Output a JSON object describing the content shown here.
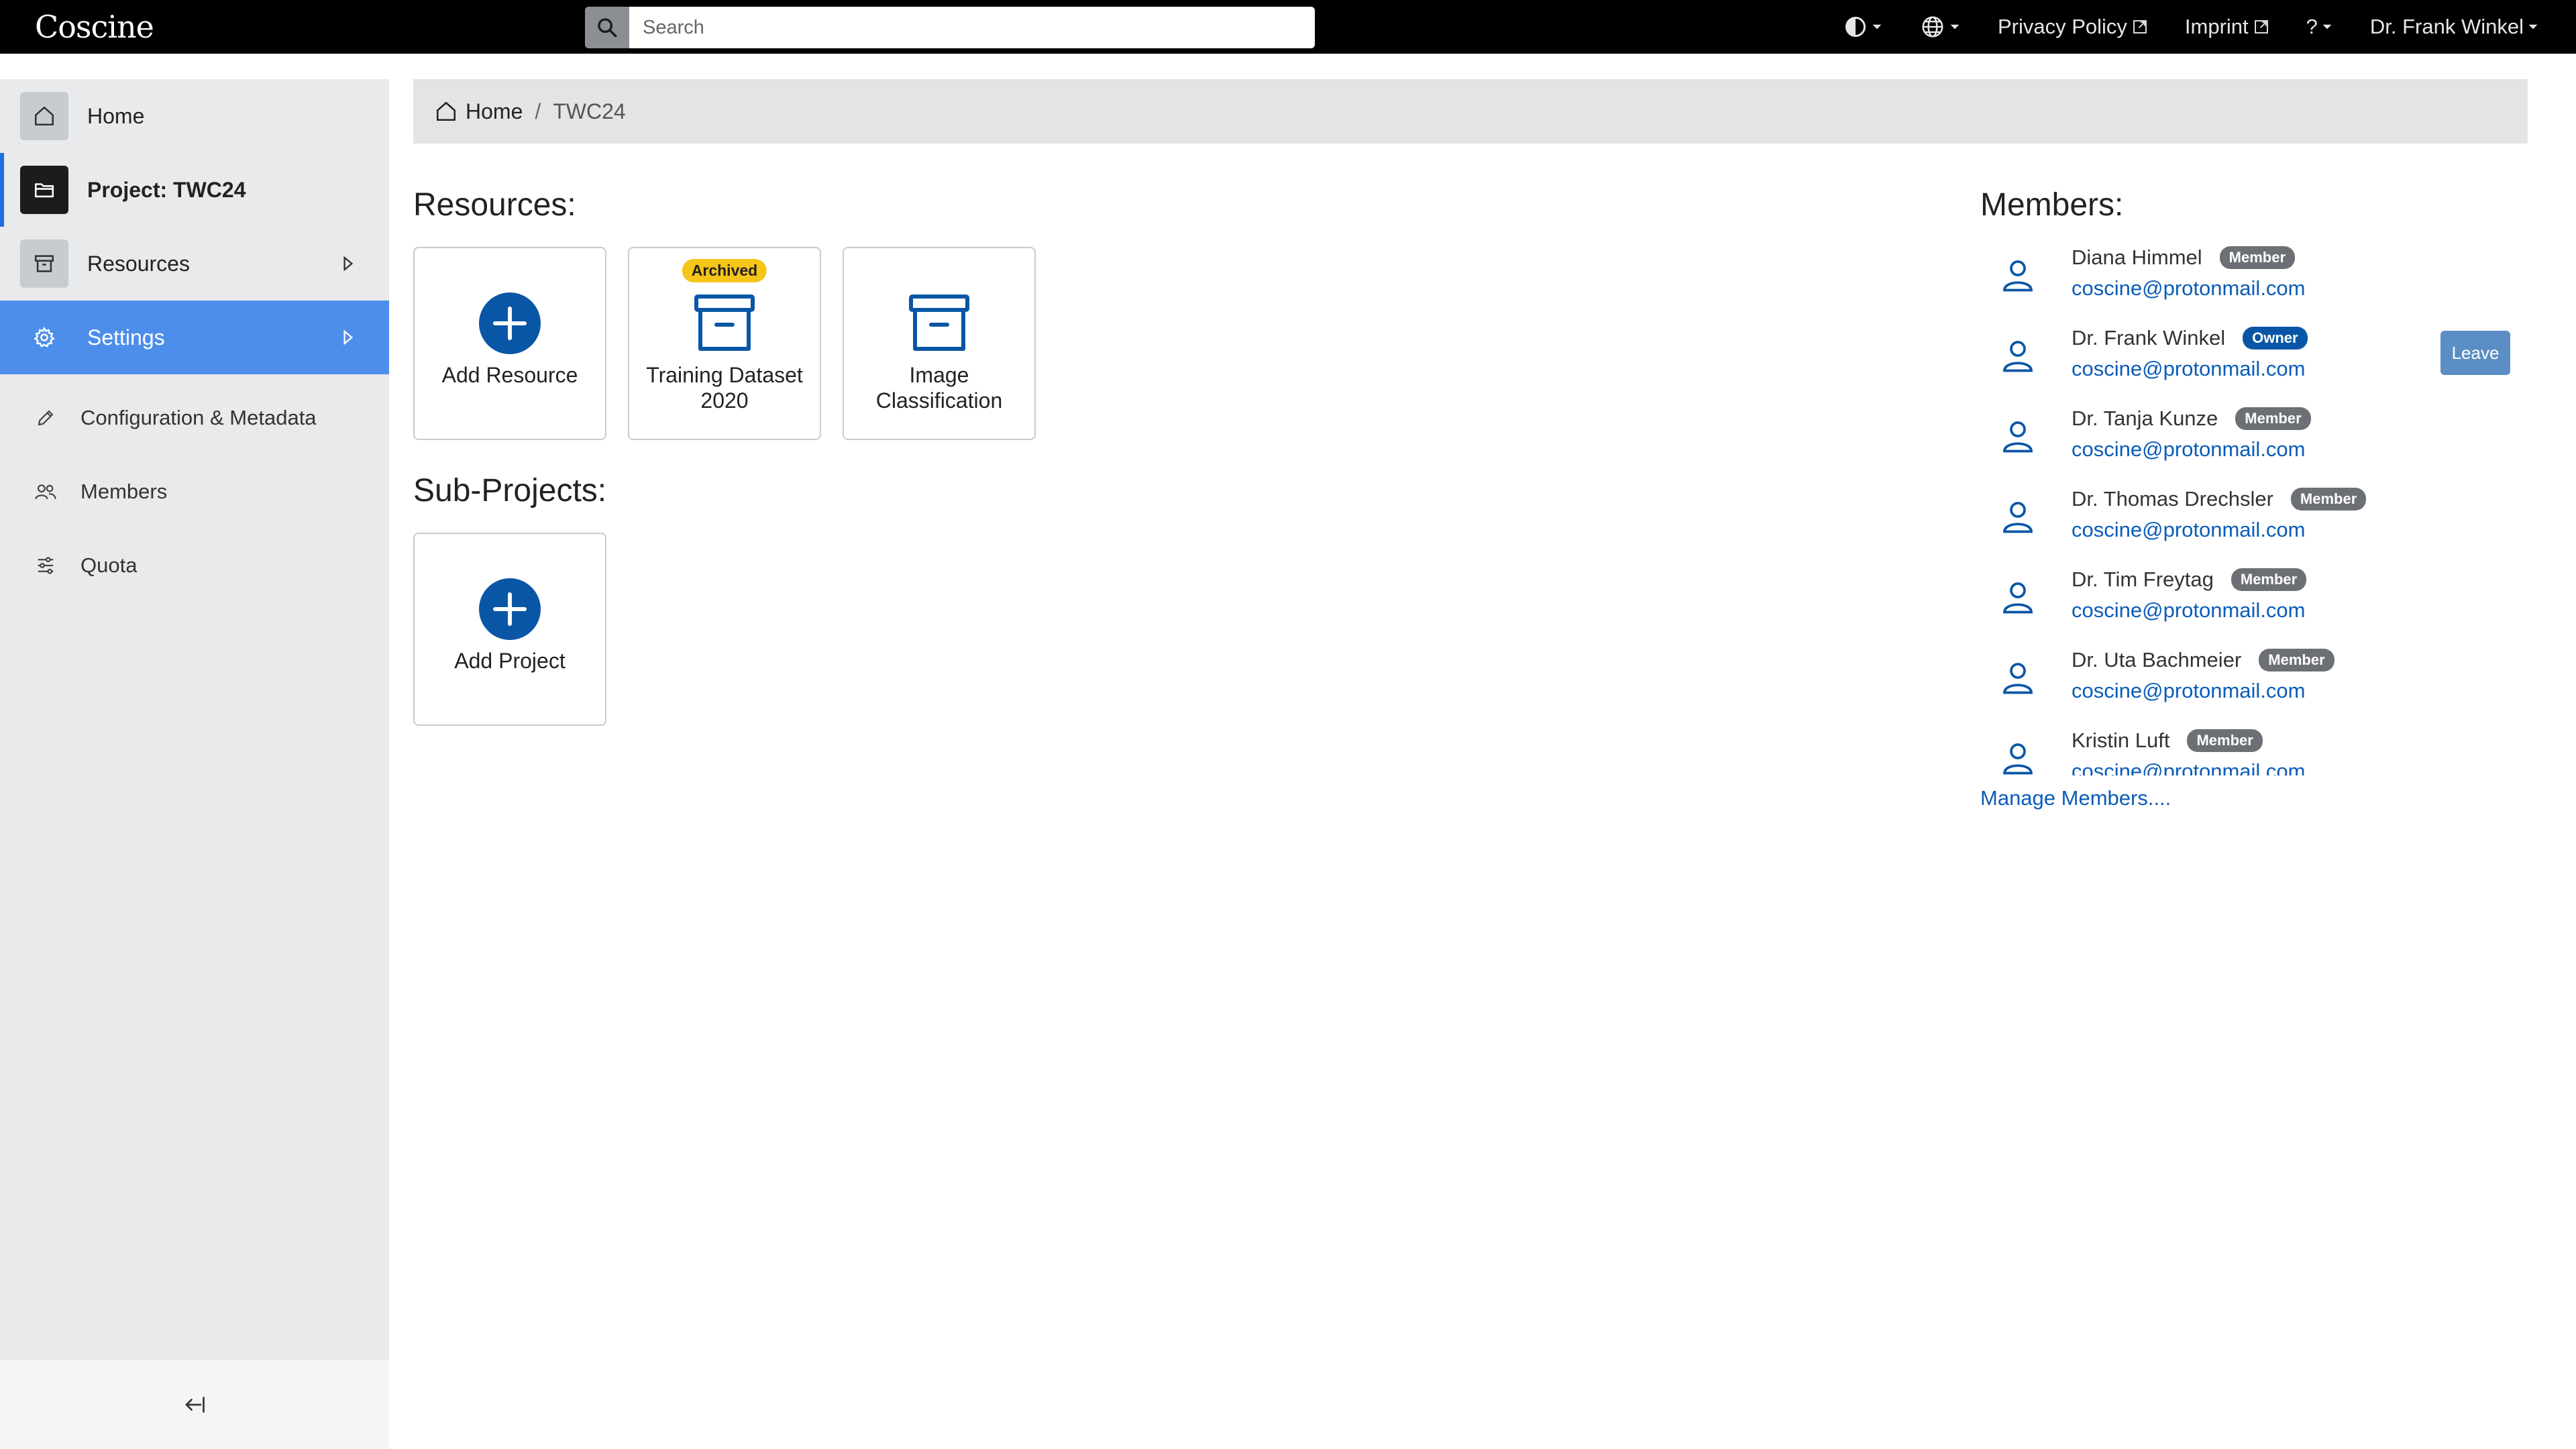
{
  "header": {
    "logo": "Coscine",
    "search_placeholder": "Search",
    "nav": {
      "theme_icon": "contrast-icon",
      "language_icon": "globe-icon",
      "privacy_policy": "Privacy Policy",
      "imprint": "Imprint",
      "help": "?",
      "user": "Dr. Frank Winkel"
    }
  },
  "sidebar": {
    "home": "Home",
    "project": "Project: TWC24",
    "resources": "Resources",
    "settings": "Settings",
    "sub": {
      "config": "Configuration & Metadata",
      "members": "Members",
      "quota": "Quota"
    },
    "collapse_icon": "collapse-sidebar-icon"
  },
  "breadcrumb": {
    "home": "Home",
    "separator": "/",
    "current": "TWC24"
  },
  "resources": {
    "title": "Resources:",
    "add_label": "Add Resource",
    "cards": [
      {
        "label": "Training Dataset 2020",
        "badge": "Archived"
      },
      {
        "label": "Image Classification"
      }
    ]
  },
  "subprojects": {
    "title": "Sub-Projects:",
    "add_label": "Add Project"
  },
  "members": {
    "title": "Members:",
    "list": [
      {
        "name": "Diana Himmel",
        "role": "Member",
        "email": "coscine@protonmail.com"
      },
      {
        "name": "Dr. Frank Winkel",
        "role": "Owner",
        "email": "coscine@protonmail.com"
      },
      {
        "name": "Dr. Tanja Kunze",
        "role": "Member",
        "email": "coscine@protonmail.com"
      },
      {
        "name": "Dr. Thomas Drechsler",
        "role": "Member",
        "email": "coscine@protonmail.com"
      },
      {
        "name": "Dr. Tim Freytag",
        "role": "Member",
        "email": "coscine@protonmail.com"
      },
      {
        "name": "Dr. Uta Bachmeier",
        "role": "Member",
        "email": "coscine@protonmail.com"
      },
      {
        "name": "Kristin Luft",
        "role": "Member",
        "email": "coscine@protonmail.com"
      }
    ],
    "leave_label": "Leave",
    "manage_label": "Manage Members...."
  },
  "colors": {
    "accent": "#4d8eea",
    "primary_dark": "#0a56a6",
    "link": "#0a5cb8",
    "archived_badge": "#f5c518"
  }
}
